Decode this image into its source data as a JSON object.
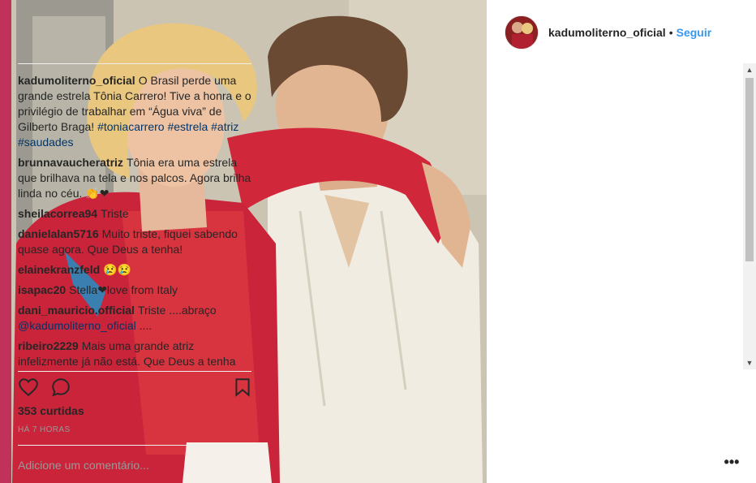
{
  "post": {
    "username": "kadumoliterno_oficial",
    "separator": "•",
    "follow_label": "Seguir"
  },
  "comments": [
    {
      "user": "kadumoliterno_oficial",
      "text": "O Brasil perde uma grande estrela Tônia Carrero! Tive a honra e o privilégio de trabalhar em “Água viva” de Gilberto Braga!",
      "tags": "#toniacarrero #estrela #atriz #saudades"
    },
    {
      "user": "brunnavaucheratriz",
      "text": "Tônia era uma estrela que brilhava na tela e nos palcos. Agora brilha linda no céu. 👏❤"
    },
    {
      "user": "sheilacorrea94",
      "text": "Triste"
    },
    {
      "user": "danielalan5716",
      "text": "Muito triste, fiquei sabendo quase agora. Que Deus a tenha!"
    },
    {
      "user": "elainekranzfeld",
      "text": "😢😢"
    },
    {
      "user": "isapac20",
      "text": "Stella❤love from Italy"
    },
    {
      "user": "dani_mauricio.official",
      "text": "Triste ....abraço",
      "tags": "@kadumoliterno_oficial",
      "after": " ...."
    },
    {
      "user": "ribeiro2229",
      "text": "Mais uma grande atriz infelizmente já não está. Que Deus a tenha em descanso. Uma excelente atriz que"
    }
  ],
  "stats": {
    "likes": "353 curtidas",
    "time": "HÁ 7 HORAS"
  },
  "add_comment": {
    "placeholder": "Adicione um comentário..."
  },
  "icons": {
    "like": "heart-icon",
    "comment": "comment-icon",
    "save": "bookmark-icon",
    "more": "more-icon"
  },
  "colors": {
    "follow": "#3897f0",
    "tag": "#003569",
    "muted": "#999999"
  }
}
